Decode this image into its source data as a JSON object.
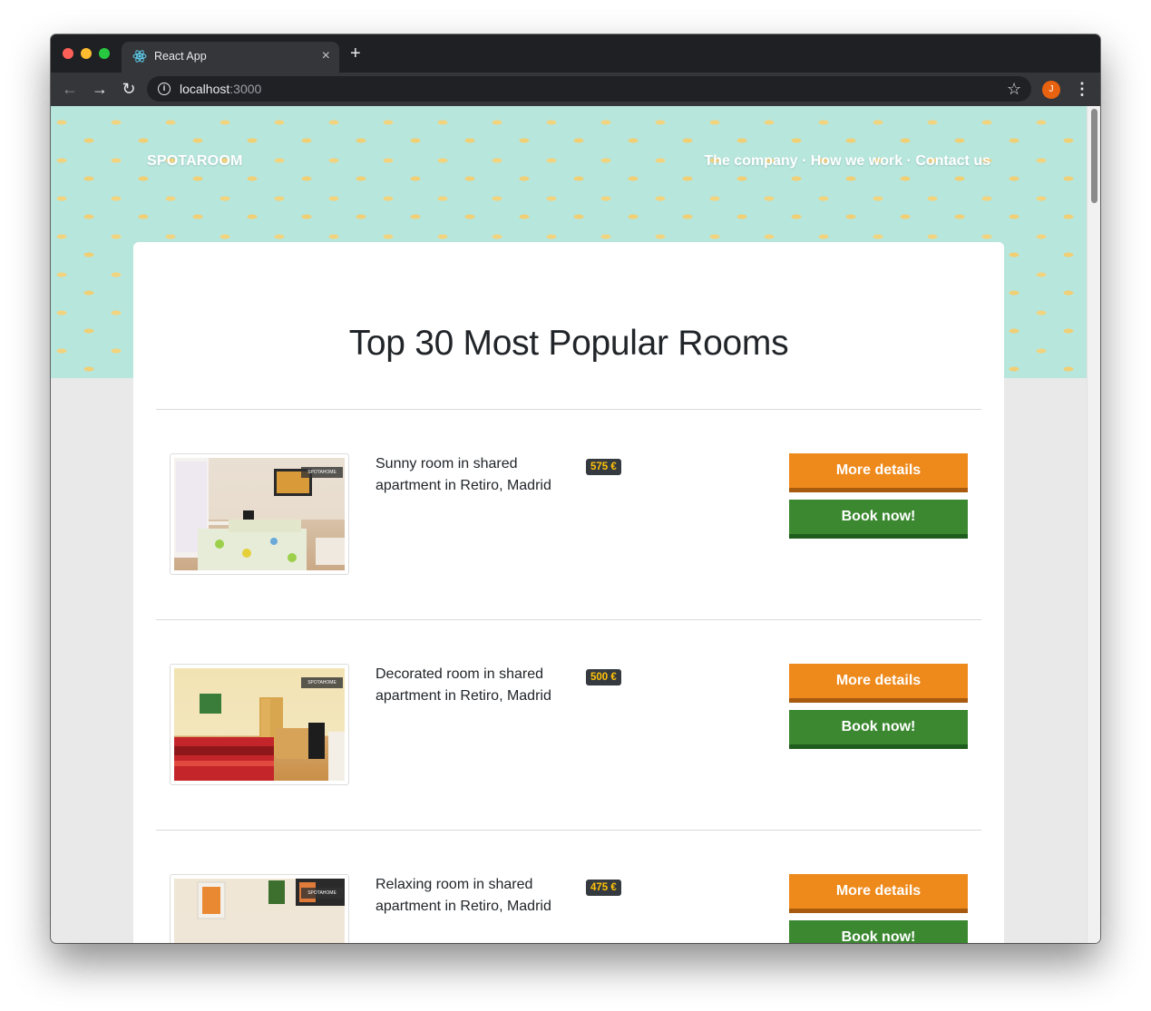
{
  "browser": {
    "tab_title": "React App",
    "tab_close": "×",
    "new_tab": "+",
    "url_host": "localhost",
    "url_port": ":3000",
    "profile_initial": "J",
    "icons": [
      "react-favicon-icon",
      "back-arrow-icon",
      "forward-arrow-icon",
      "reload-icon",
      "info-icon",
      "star-icon",
      "kebab-menu-icon"
    ]
  },
  "header": {
    "brand": "SPOTAROOM",
    "nav": [
      "The company",
      "How we work",
      "Contact us"
    ],
    "nav_separator": " · "
  },
  "main": {
    "title": "Top 30 Most Popular Rooms"
  },
  "rooms": [
    {
      "title": "Sunny room in shared apartment in Retiro, Madrid",
      "price": "575 €",
      "details_label": "More details",
      "book_label": "Book now!"
    },
    {
      "title": "Decorated room in shared apartment in Retiro, Madrid",
      "price": "500 €",
      "details_label": "More details",
      "book_label": "Book now!"
    },
    {
      "title": "Relaxing room in shared apartment in Retiro, Madrid",
      "price": "475 €",
      "details_label": "More details",
      "book_label": "Book now!"
    }
  ],
  "colors": {
    "hero_bg": "#b7e6dd",
    "details_button": "#ee8a1c",
    "book_button": "#3b8830",
    "price_badge_bg": "#343a40",
    "price_badge_text": "#ffc107"
  }
}
